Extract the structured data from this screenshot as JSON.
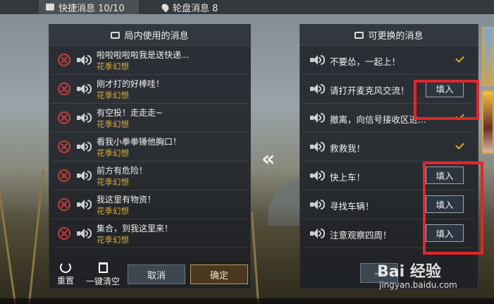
{
  "tabs": {
    "quick": "快捷消息 10/10",
    "wheel": "轮盘消息 8"
  },
  "left_panel": {
    "title": "局内使用的消息",
    "messages": [
      {
        "text": "啦啦啦啦啦我是送快递...",
        "author": "花季幻想"
      },
      {
        "text": "刚才打的好棒哇！",
        "author": "花季幻想"
      },
      {
        "text": "有空投！走走走~",
        "author": "花季幻想"
      },
      {
        "text": "看我小拳拳锤他胸口！",
        "author": "花季幻想"
      },
      {
        "text": "前方有危险！",
        "author": "花季幻想"
      },
      {
        "text": "我这里有物资！",
        "author": "花季幻想"
      },
      {
        "text": "集合，到我这里来！",
        "author": "花季幻想"
      }
    ],
    "reset_label": "重置",
    "clear_label": "一键清空",
    "cancel_label": "取消",
    "confirm_label": "确定"
  },
  "right_panel": {
    "title": "可更换的消息",
    "messages": [
      {
        "text": "不要怂，一起上！",
        "state": "selected"
      },
      {
        "text": "请打开麦克风交流！",
        "state": "fill",
        "button": "填入"
      },
      {
        "text": "撤离，向信号接收区进...",
        "state": "selected"
      },
      {
        "text": "救救我！",
        "state": "selected"
      },
      {
        "text": "快上车！",
        "state": "fill",
        "button": "填入"
      },
      {
        "text": "寻找车辆！",
        "state": "fill",
        "button": "填入"
      },
      {
        "text": "注意观察四周！",
        "state": "fill",
        "button": "填入"
      }
    ],
    "bottom_label": "一"
  },
  "arrow_glyph": "«",
  "watermark": {
    "logo": "Bai  经验",
    "url": "jingyan.baidu.com"
  },
  "colors": {
    "author": "#d9a83c",
    "check": "#e0a92e",
    "delete": "#c43c3c",
    "highlight": "#e0262b"
  }
}
